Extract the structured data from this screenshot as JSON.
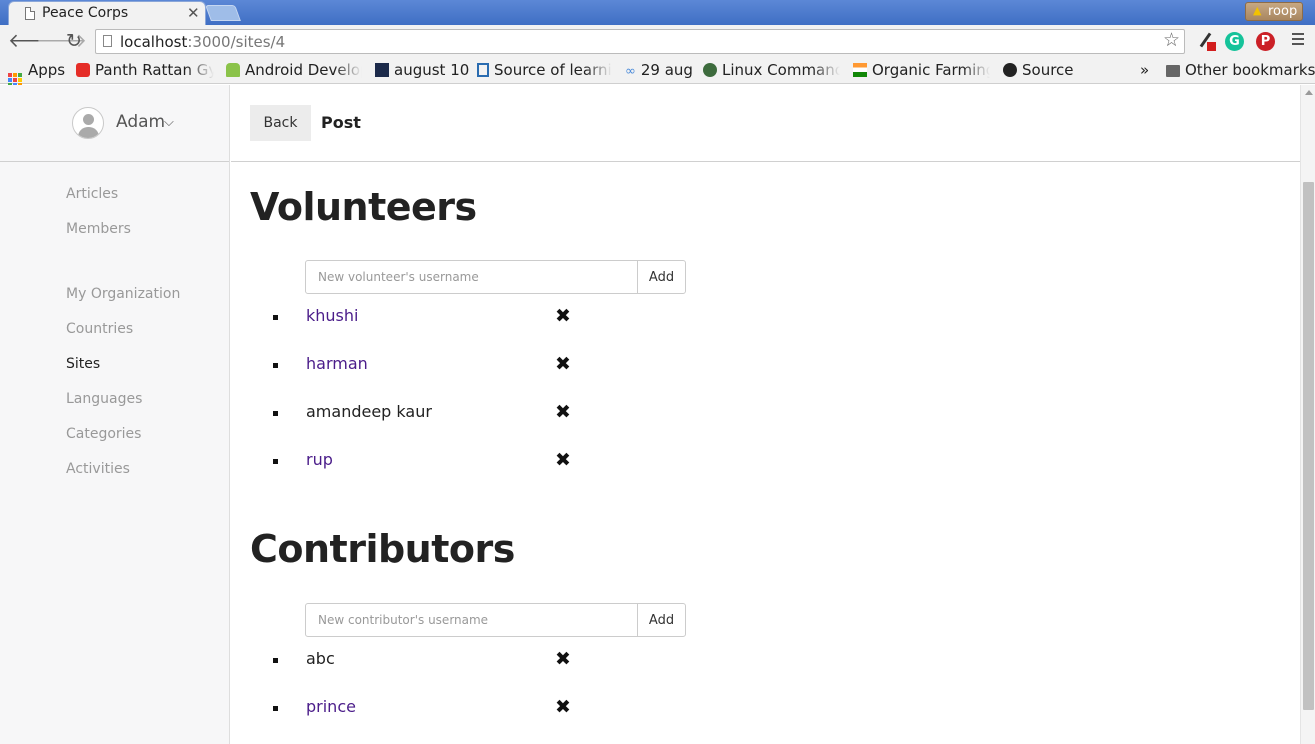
{
  "browser": {
    "tab_title": "Peace Corps",
    "tab_close": "✕",
    "profile_name": "roop",
    "url_host": "localhost",
    "url_path": ":3000/sites/4"
  },
  "bookmarks": {
    "apps": "Apps",
    "items": [
      "Panth Rattan Gya",
      "Android Develop",
      "august 10",
      "Source of learnin",
      "29 aug",
      "Linux Commands",
      "Organic Farming",
      "Source"
    ],
    "overflow": "»",
    "other": "Other bookmarks"
  },
  "sidebar": {
    "user_name": "Adam",
    "chevron": "⌵",
    "items": [
      "Articles",
      "Members",
      "My Organization",
      "Countries",
      "Sites",
      "Languages",
      "Categories",
      "Activities"
    ],
    "active_item": "Sites"
  },
  "header": {
    "back_label": "Back",
    "title": "Post"
  },
  "volunteers": {
    "heading": "Volunteers",
    "placeholder": "New volunteer's username",
    "add_label": "Add",
    "items": [
      {
        "name": "khushi",
        "link": true
      },
      {
        "name": "harman",
        "link": true
      },
      {
        "name": "amandeep kaur",
        "link": false
      },
      {
        "name": "rup",
        "link": true
      }
    ]
  },
  "contributors": {
    "heading": "Contributors",
    "placeholder": "New contributor's username",
    "add_label": "Add",
    "items": [
      {
        "name": "abc",
        "link": false
      },
      {
        "name": "prince",
        "link": true
      }
    ]
  },
  "remove_glyph": "✖",
  "colors": {
    "link": "#4b1d8a",
    "chrome_blue": "#4a78cc",
    "sidebar_bg": "#f7f7f8"
  }
}
